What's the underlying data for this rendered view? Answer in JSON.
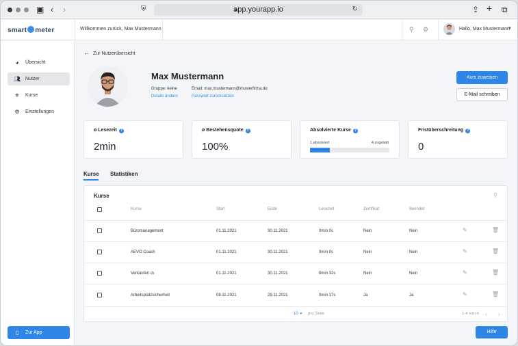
{
  "browser": {
    "url": "app.yourapp.io"
  },
  "header": {
    "logo_left": "smart",
    "logo_right": "meter",
    "welcome": "Willkommen zurück, Max Mustermann",
    "greeting": "Hallo, Max Mustermann"
  },
  "sidebar": {
    "items": [
      {
        "label": "Übersicht",
        "icon": "pie-chart-icon"
      },
      {
        "label": "Nutzer",
        "icon": "users-icon"
      },
      {
        "label": "Kurse",
        "icon": "award-icon"
      },
      {
        "label": "Einstellungen",
        "icon": "gear-icon"
      }
    ],
    "app_button": "Zur App"
  },
  "profile": {
    "back_label": "Zur Nutzerübersicht",
    "name": "Max Mustermann",
    "group": "Gruppe: keine",
    "email": "Email: max.mustermann@musterfirma.de",
    "edit_details": "Details ändern",
    "reset_password": "Passwort zurücksetzen",
    "assign_button": "Kurs zuweisen",
    "email_button": "E-Mail schreiben"
  },
  "stats": {
    "reading_time": {
      "title": "ø Lesezeit",
      "value": "2min"
    },
    "pass_rate": {
      "title": "ø Bestehensquote",
      "value": "100%"
    },
    "completed": {
      "title": "Absolvierte Kurse",
      "done_label": "1 absolviert",
      "assigned_label": "4 zugeteilt",
      "progress": 0.25
    },
    "overdue": {
      "title": "Fristüberschreitung",
      "value": "0"
    }
  },
  "tabs": [
    "Kurse",
    "Statistiken"
  ],
  "table": {
    "title": "Kurse",
    "columns": [
      "Kurse",
      "Start",
      "Ende",
      "Lesezeit",
      "Zertifikat",
      "Beendet"
    ],
    "rows": [
      [
        "Büromanagement",
        "01.11.2021",
        "30.11.2021",
        "0min 0s",
        "Nein",
        "Nein"
      ],
      [
        "AEVO Coach",
        "01.11.2021",
        "30.11.2021",
        "0min 0s",
        "Nein",
        "Nein"
      ],
      [
        "Verkäufer/-in",
        "01.11.2021",
        "30.11.2021",
        "8min 32s",
        "Nein",
        "Nein"
      ],
      [
        "Arbeitsplatzsicherheit",
        "08.11.2021",
        "29.11.2021",
        "0min 17s",
        "Ja",
        "Ja"
      ]
    ],
    "page_size": "10",
    "per_page_label": "pro Seite",
    "range_label": "1-4 von 4"
  },
  "help_button": "Hilfe",
  "colors": {
    "accent": "#2f86e6"
  }
}
